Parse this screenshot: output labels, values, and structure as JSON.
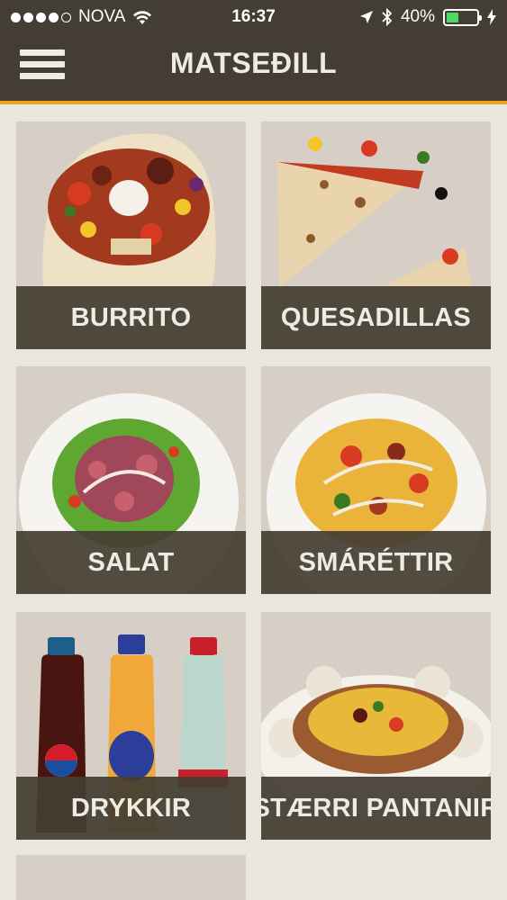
{
  "status_bar": {
    "carrier": "NOVA",
    "time": "16:37",
    "battery": "40%",
    "battery_level": 0.4
  },
  "header": {
    "title": "MATSEÐILL"
  },
  "menu": {
    "items": [
      {
        "label": "BURRITO"
      },
      {
        "label": "QUESADILLAS"
      },
      {
        "label": "SALAT"
      },
      {
        "label": "SMÁRÉTTIR"
      },
      {
        "label": "DRYKKIR"
      },
      {
        "label": "STÆRRI PANTANIR"
      }
    ]
  },
  "colors": {
    "header_bg": "#443d33",
    "accent": "#f0a21e",
    "page_bg": "#e9e5df",
    "tile_bg": "#d6cec4",
    "label_text": "#efeae2"
  }
}
